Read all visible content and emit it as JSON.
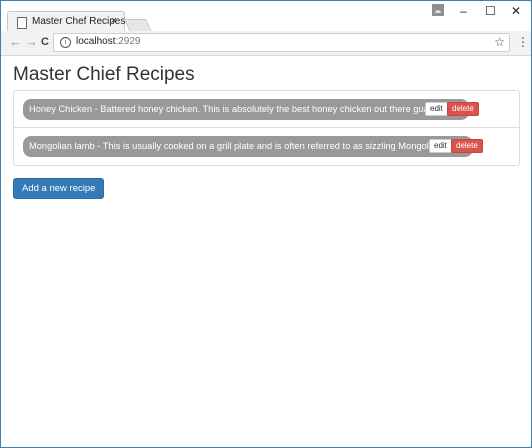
{
  "browser": {
    "tab_title": "Master Chef Recipes",
    "tab_close": "×",
    "url_host": "localhost",
    "url_port": ":2929",
    "back": "←",
    "forward": "→",
    "reload": "C",
    "star": "☆",
    "menu": "⋮",
    "minimize": "–",
    "maximize": "☐",
    "close": "✕"
  },
  "page": {
    "heading": "Master Chief Recipes",
    "recipes": [
      {
        "text": "Honey Chicken - Battered honey chicken. This is absolutely the best honey chicken out there guaranteed.",
        "edit": "edit",
        "delete": "delete"
      },
      {
        "text": "Mongolian lamb - This is usually cooked on a grill plate and is often referred to as sizzling Mongolian lamb.",
        "edit": "edit",
        "delete": "delete"
      }
    ],
    "add_button": "Add a new recipe"
  }
}
